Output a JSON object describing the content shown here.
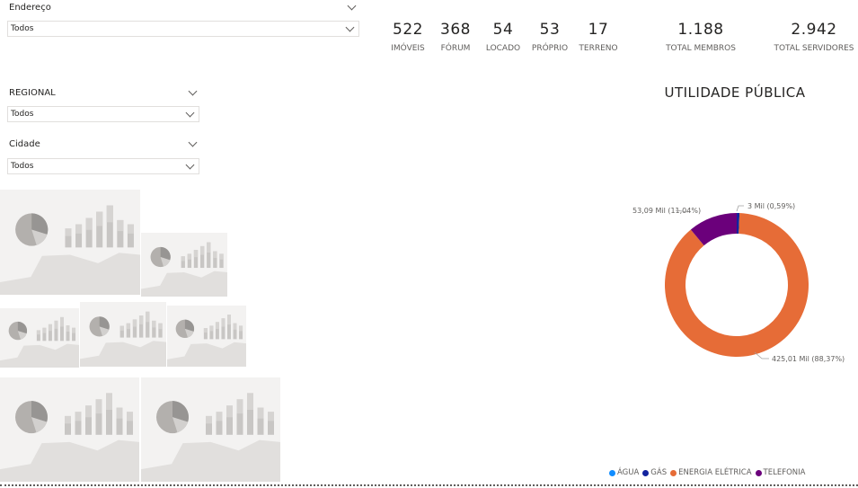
{
  "slicers": {
    "endereco": {
      "title": "Endereço",
      "value": "Todos"
    },
    "regional": {
      "title": "REGIONAL",
      "value": "Todos"
    },
    "cidade": {
      "title": "Cidade",
      "value": "Todos"
    }
  },
  "kpis": [
    {
      "value": "522",
      "label": "IMÓVEIS"
    },
    {
      "value": "368",
      "label": "FÓRUM"
    },
    {
      "value": "54",
      "label": "LOCADO"
    },
    {
      "value": "53",
      "label": "PRÓPRIO"
    },
    {
      "value": "17",
      "label": "TERRENO"
    },
    {
      "value": "1.188",
      "label": "TOTAL MEMBROS"
    },
    {
      "value": "2.942",
      "label": "TOTAL SERVIDORES"
    }
  ],
  "chart_data": {
    "type": "pie",
    "title": "UTILIDADE PÚBLICA",
    "slices": [
      {
        "name": "ÁGUA",
        "value": 0.0,
        "percent": 0.0,
        "color": "#118dff",
        "label": ""
      },
      {
        "name": "GÁS",
        "value": 3.0,
        "percent": 0.59,
        "color": "#12239e",
        "label": "3 Mil (0,59%)"
      },
      {
        "name": "ENERGIA ELÉTRICA",
        "value": 425.01,
        "percent": 88.37,
        "color": "#e66c37",
        "label": "425,01 Mil (88,37%)"
      },
      {
        "name": "TELEFONIA",
        "value": 53.09,
        "percent": 11.04,
        "color": "#6b007b",
        "label": "53,09 Mil (11,04%)"
      }
    ],
    "legend_position": "bottom"
  },
  "colors": {
    "accent": "#e66c37",
    "placeholder": "#f3f2f1"
  }
}
